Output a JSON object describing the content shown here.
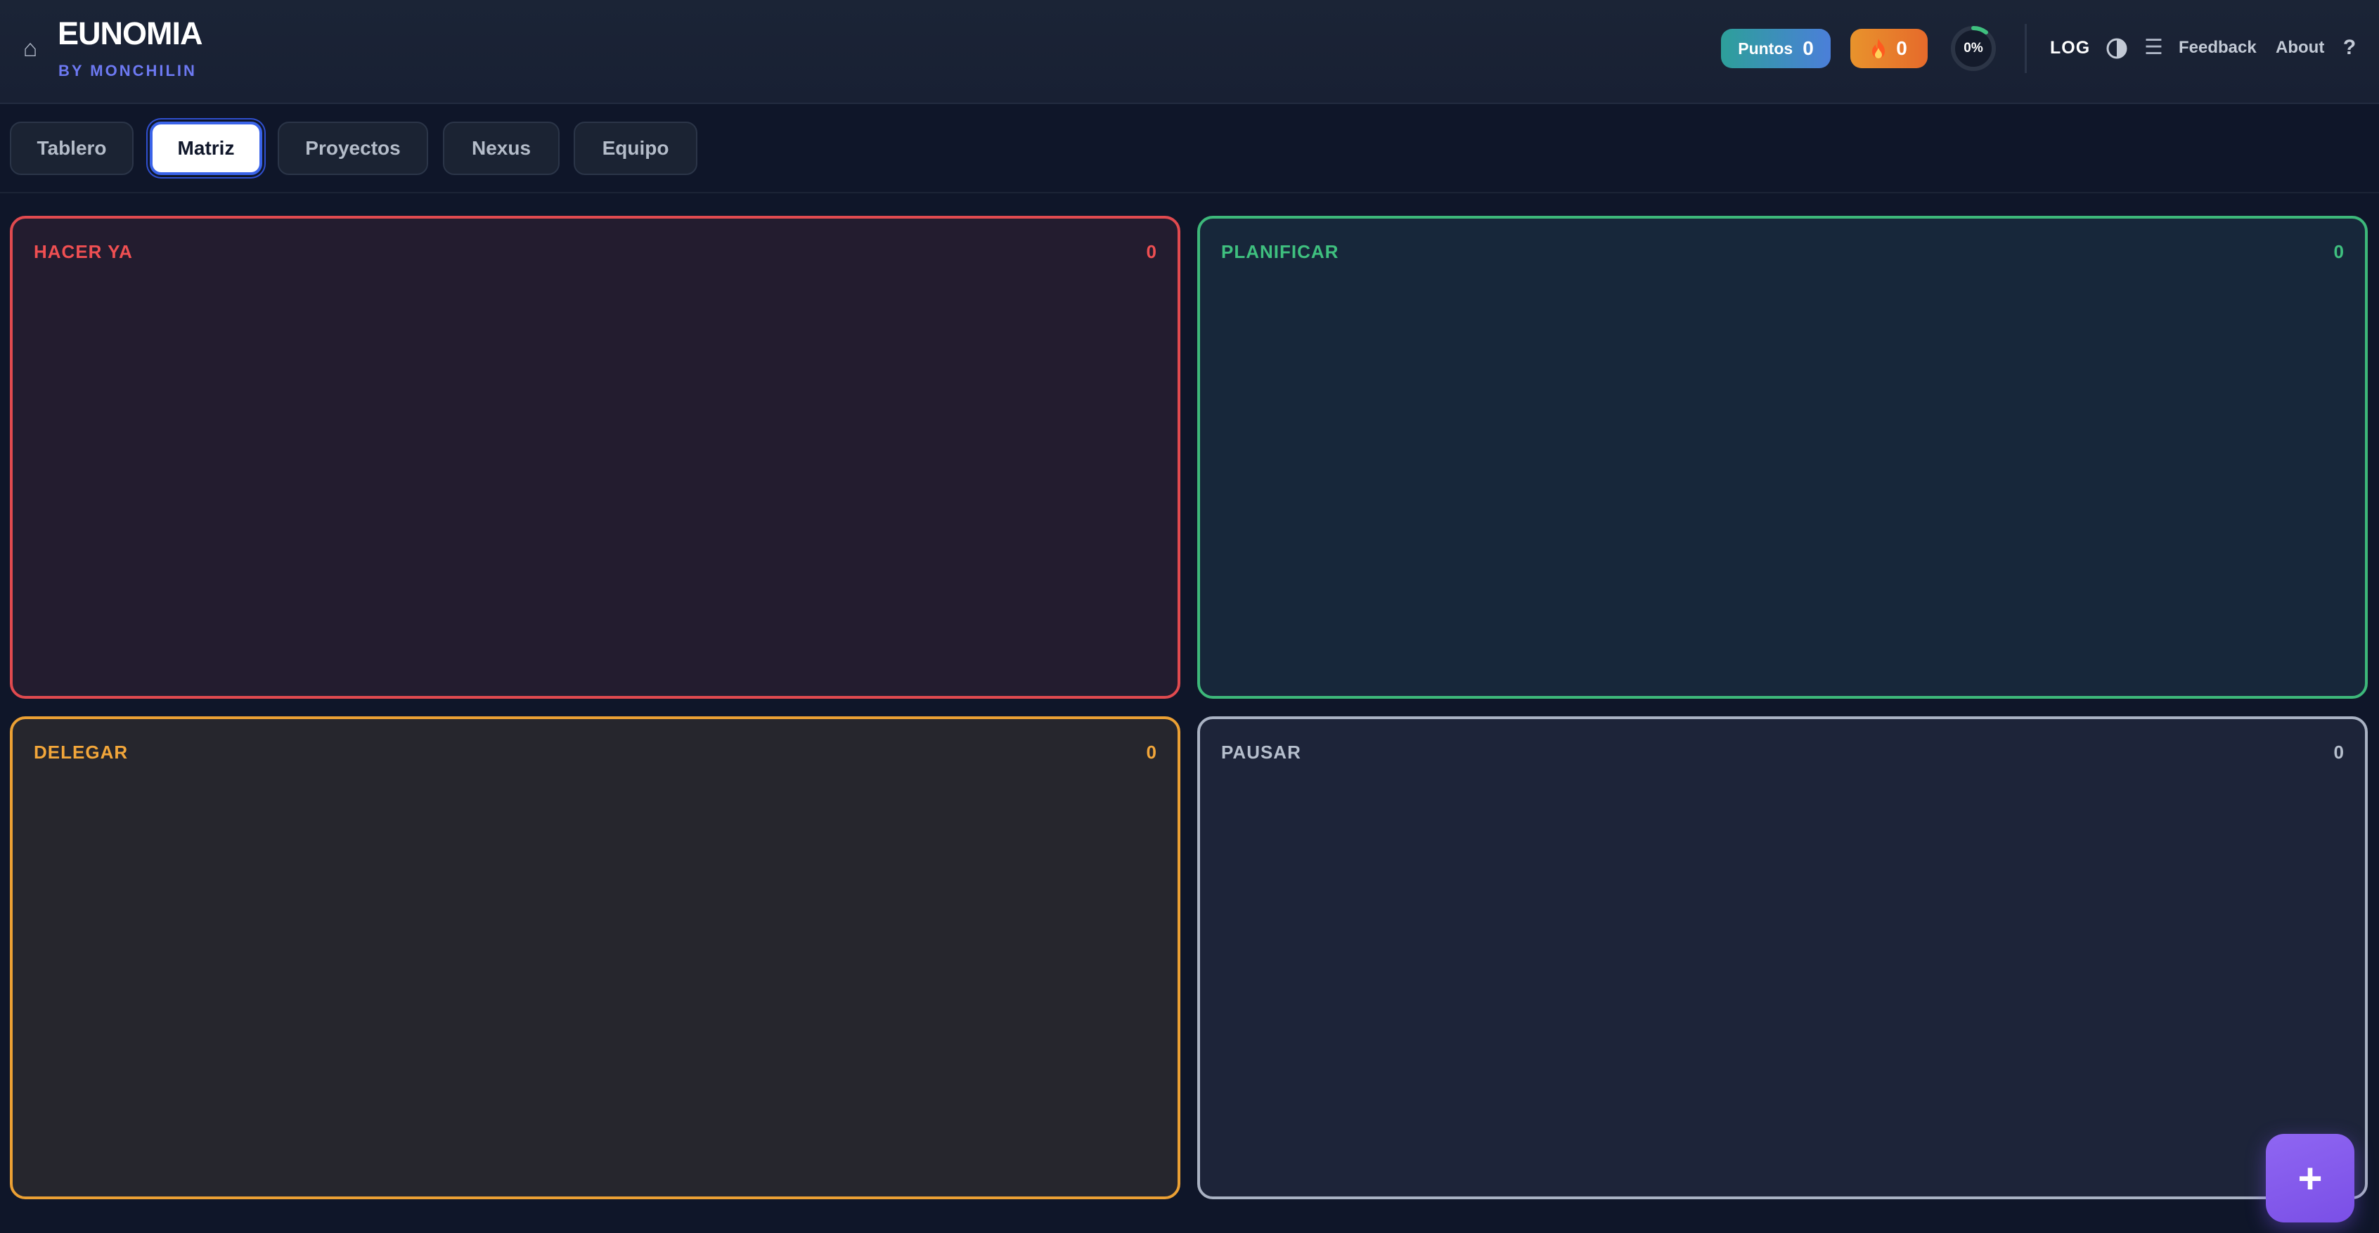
{
  "header": {
    "home_icon": "⌂",
    "title": "EUNOMIA",
    "subtitle": "BY MONCHILIN",
    "points_label": "Puntos",
    "points_value": "0",
    "streak_icon": "fire-icon",
    "streak_value": "0",
    "progress_text": "0%",
    "progress_fraction": 0,
    "log_label": "LOG",
    "theme_icon": "half-circle-icon",
    "menu_icon": "☰",
    "feedback_label": "Feedback",
    "about_label": "About",
    "help_label": "?"
  },
  "tabs": [
    {
      "label": "Tablero",
      "active": false
    },
    {
      "label": "Matriz",
      "active": true
    },
    {
      "label": "Proyectos",
      "active": false
    },
    {
      "label": "Nexus",
      "active": false
    },
    {
      "label": "Equipo",
      "active": false
    }
  ],
  "quadrants": {
    "do_now": {
      "title": "HACER YA",
      "count": "0",
      "color": "#ef4f52"
    },
    "plan": {
      "title": "PLANIFICAR",
      "count": "0",
      "color": "#3fc07f"
    },
    "delegate": {
      "title": "DELEGAR",
      "count": "0",
      "color": "#f2a63a"
    },
    "pause": {
      "title": "PAUSAR",
      "count": "0",
      "color": "#b6bfcd"
    }
  },
  "fab": {
    "label": "+"
  },
  "colors": {
    "background": "#0f1629",
    "accent": "#7a4fe6",
    "active_tab_border": "#3a63e8"
  }
}
